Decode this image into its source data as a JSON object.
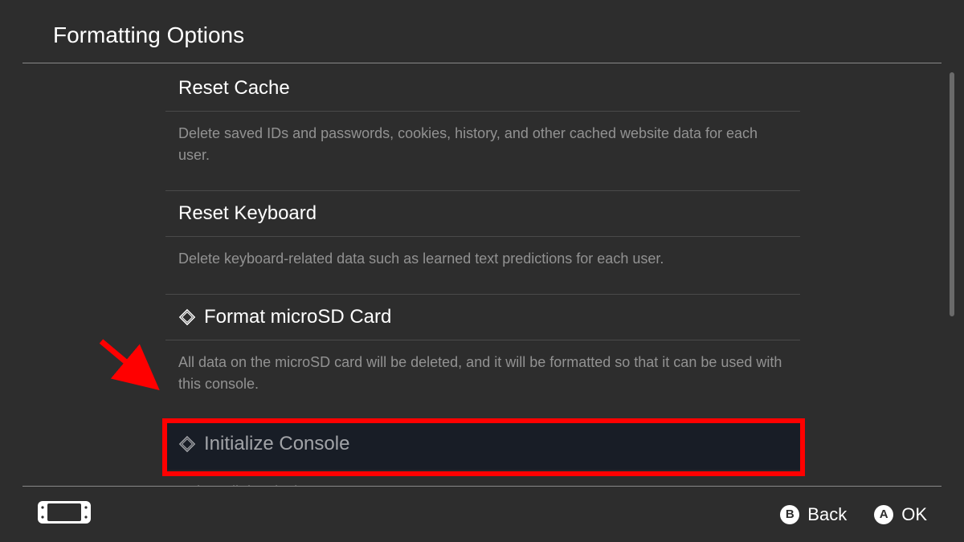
{
  "header": {
    "title": "Formatting Options"
  },
  "options": [
    {
      "title": "Reset Cache",
      "desc": "Delete saved IDs and passwords, cookies, history, and other cached website data for each user.",
      "icon": false
    },
    {
      "title": "Reset Keyboard",
      "desc": "Delete keyboard-related data such as learned text predictions for each user.",
      "icon": false
    },
    {
      "title": "Format microSD Card",
      "desc": "All data on the microSD card will be deleted, and it will be formatted so that it can be used with this console.",
      "icon": true
    },
    {
      "title": "Initialize Console",
      "desc": "Delete all data in the system memory.",
      "icon": true,
      "highlighted": true
    }
  ],
  "footer": {
    "back_letter": "B",
    "back_label": "Back",
    "ok_letter": "A",
    "ok_label": "OK"
  },
  "annotation": {
    "arrow_color": "#ff0000",
    "highlight_color": "#ff0000"
  }
}
